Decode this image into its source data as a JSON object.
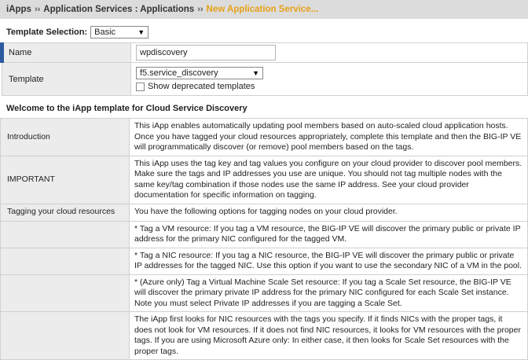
{
  "breadcrumb": {
    "items": [
      "iApps",
      "Application Services : Applications"
    ],
    "separator": "››",
    "current": "New Application Service..."
  },
  "template_selection": {
    "label": "Template Selection:",
    "value": "Basic"
  },
  "form": {
    "name_label": "Name",
    "name_value": "wpdiscovery",
    "template_label": "Template",
    "template_value": "f5.service_discovery",
    "show_deprecated_label": "Show deprecated templates"
  },
  "welcome_heading": "Welcome to the iApp template for Cloud Service Discovery",
  "info_rows": [
    {
      "label": "Introduction",
      "text": "This iApp enables automatically updating pool members based on auto-scaled cloud application hosts. Once you have tagged your cloud resources appropriately, complete this template and then the BIG-IP VE will programmatically discover (or remove) pool members based on the tags."
    },
    {
      "label": "IMPORTANT",
      "text": "This iApp uses the tag key and tag values you configure on your cloud provider to discover pool members. Make sure the tags and IP addresses you use are unique. You should not tag multiple nodes with the same key/tag combination if those nodes use the same IP address. See your cloud provider documentation for specific information on tagging."
    },
    {
      "label": "Tagging your cloud resources",
      "text": "You have the following options for tagging nodes on your cloud provider."
    },
    {
      "label": "",
      "text": "* Tag a VM resource: If you tag a VM resource, the BIG-IP VE will discover the primary public or private IP address for the primary NIC configured for the tagged VM."
    },
    {
      "label": "",
      "text": "* Tag a NIC resource: If you tag a NIC resource, the BIG-IP VE will discover the primary public or private IP addresses for the tagged NIC. Use this option if you want to use the secondary NIC of a VM in the pool."
    },
    {
      "label": "",
      "text": "* (Azure only) Tag a Virtual Machine Scale Set resource: If you tag a Scale Set resource, the BIG-IP VE will discover the primary private IP address for the primary NIC configured for each Scale Set instance. Note you must select Private IP addresses if you are tagging a Scale Set."
    },
    {
      "label": "",
      "text": "The iApp first looks for NIC resources with the tags you specify. If it finds NICs with the proper tags, it does not look for VM resources. If it does not find NIC resources, it looks for VM resources with the proper tags. If you are using Microsoft Azure only: In either case, it then looks for Scale Set resources with the proper tags."
    }
  ]
}
